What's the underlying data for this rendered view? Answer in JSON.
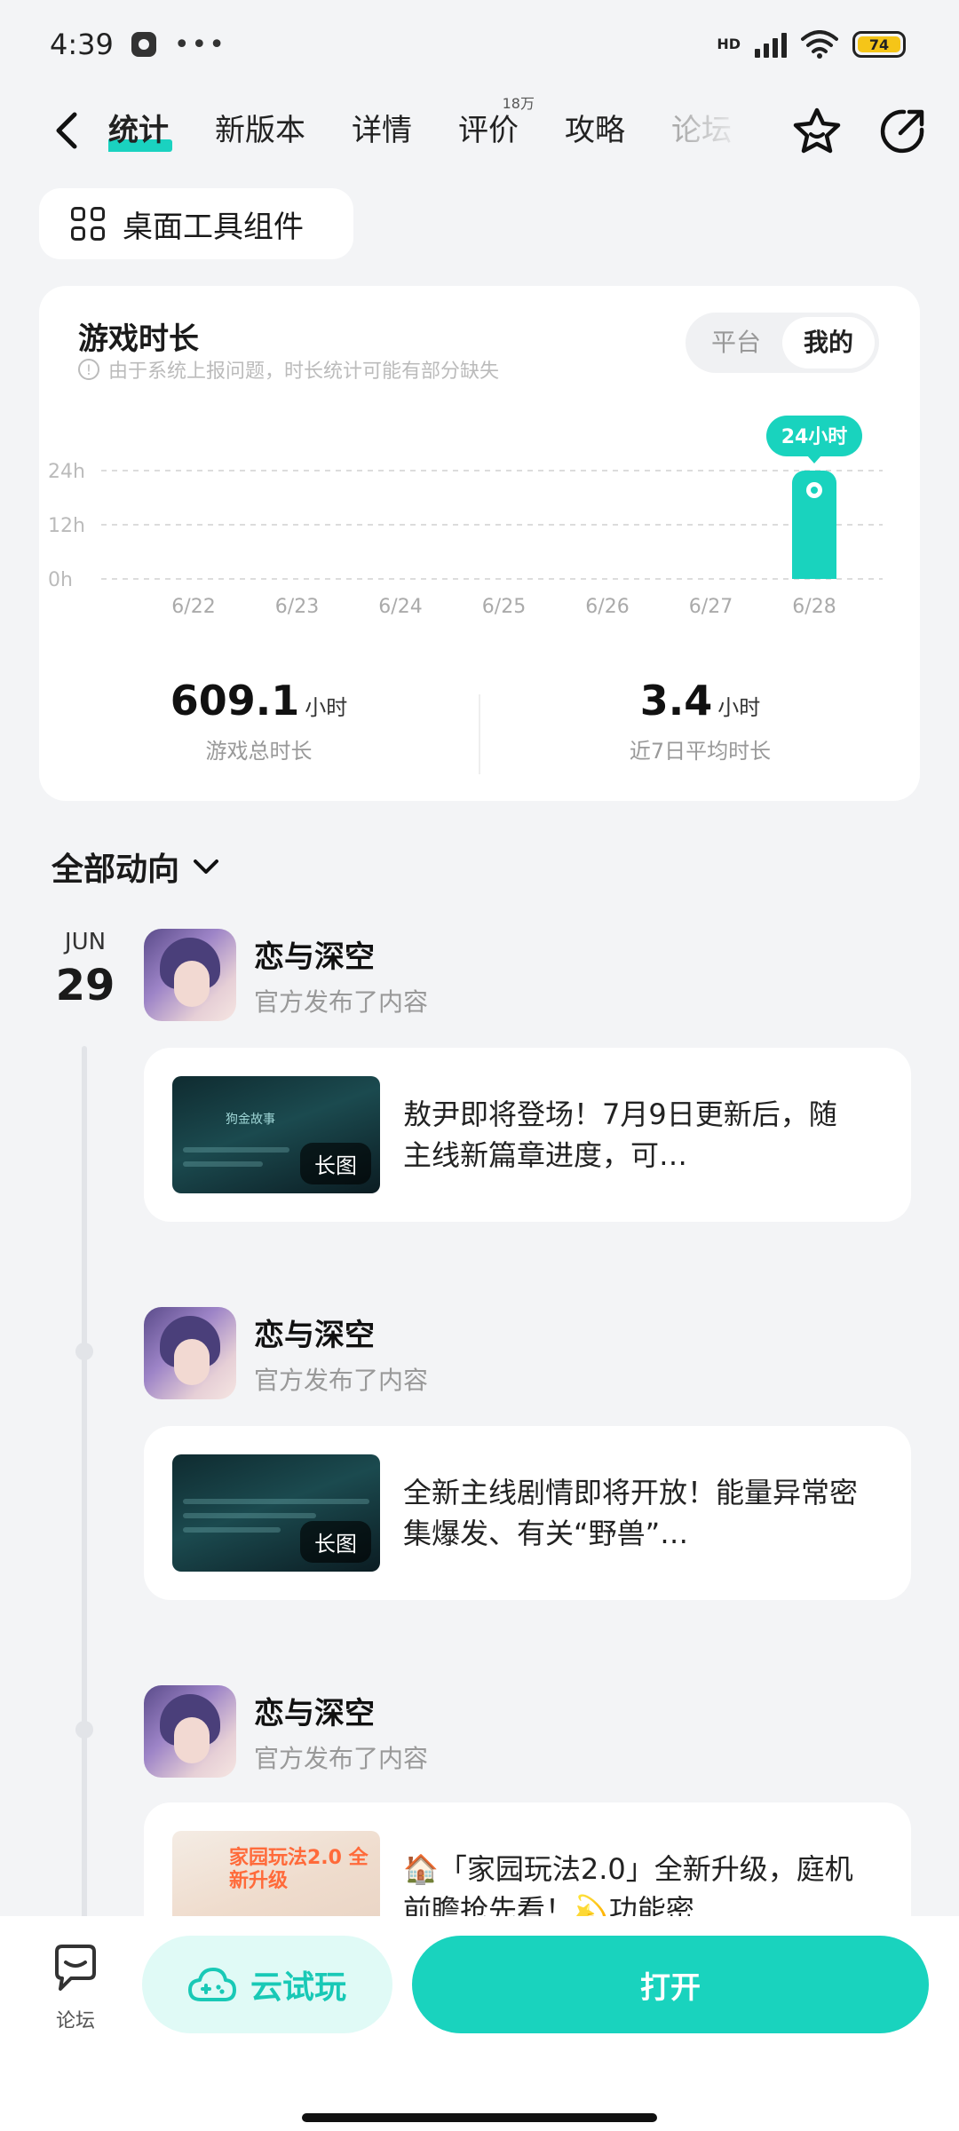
{
  "status_bar": {
    "time": "4:39",
    "more": "•••",
    "network": "HD",
    "battery": "74"
  },
  "nav": {
    "tabs": [
      {
        "label": "统计",
        "active": true
      },
      {
        "label": "新版本"
      },
      {
        "label": "详情"
      },
      {
        "label": "评价",
        "sup": "18万"
      },
      {
        "label": "攻略"
      },
      {
        "label": "论坛"
      }
    ]
  },
  "widget_chip": {
    "label": "桌面工具组件"
  },
  "playtime": {
    "title": "游戏时长",
    "note": "由于系统上报问题，时长统计可能有部分缺失",
    "toggle": [
      "平台",
      "我的"
    ],
    "total_value": "609.1",
    "total_unit": "小时",
    "total_label": "游戏总时长",
    "avg_value": "3.4",
    "avg_unit": "小时",
    "avg_label": "近7日平均时长"
  },
  "chart_data": {
    "type": "bar",
    "categories": [
      "6/22",
      "6/23",
      "6/24",
      "6/25",
      "6/26",
      "6/27",
      "6/28"
    ],
    "values": [
      0,
      0,
      0,
      0,
      0,
      0,
      24
    ],
    "y_ticks": [
      "24h",
      "12h",
      "0h"
    ],
    "ylim": [
      0,
      24
    ],
    "highlight_label": "24小时",
    "highlight_index": 6,
    "color": "#19d3be"
  },
  "dynamics": {
    "header": "全部动向",
    "date_month": "JUN",
    "date_day": "29",
    "posts": [
      {
        "name": "恋与深空",
        "sub": "官方发布了内容",
        "text": "敖尹即将登场！7月9日更新后，随主线新篇章进度，可…",
        "badge": "长图",
        "thumb_title": "狗金故事"
      },
      {
        "name": "恋与深空",
        "sub": "官方发布了内容",
        "text": "全新主线剧情即将开放！能量异常密集爆发、有关“野兽”…",
        "badge": "长图"
      },
      {
        "name": "恋与深空",
        "sub": "官方发布了内容",
        "text": "🏠「家园玩法2.0」全新升级，庭机前瞻抢先看！💫功能密…",
        "thumb_title": "家园玩法2.0 全新升级"
      }
    ]
  },
  "bottom_bar": {
    "forum_label": "论坛",
    "cloud_label": "云试玩",
    "open_label": "打开"
  },
  "colors": {
    "accent": "#19d3be"
  }
}
